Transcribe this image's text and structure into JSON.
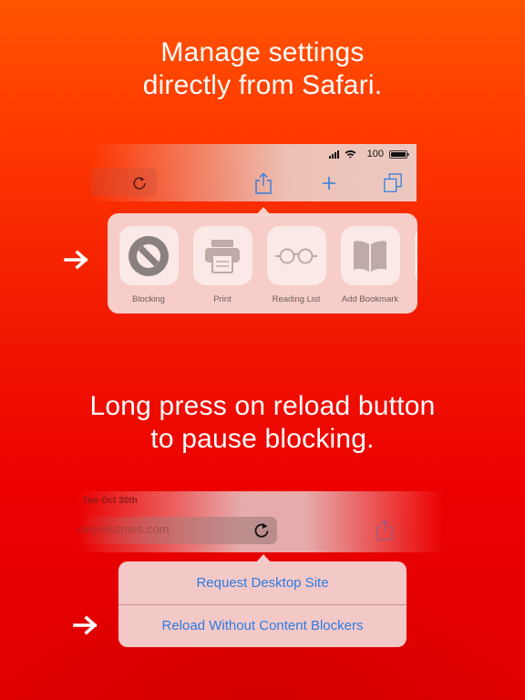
{
  "headlines": {
    "top": "Manage settings directly from Safari.",
    "bottom": "Long press on reload button to pause blocking."
  },
  "top_browser": {
    "status_bar": {
      "signal_icon": "cellular-signal-icon",
      "wifi_icon": "wifi-icon",
      "battery_percent": "100",
      "battery_icon": "battery-full-icon"
    },
    "toolbar": {
      "reload_icon": "reload-icon",
      "share_icon": "share-icon",
      "new_tab_icon": "plus-icon",
      "tabs_icon": "tabs-icon"
    },
    "share_sheet": {
      "actions": [
        {
          "label": "Blocking",
          "icon": "blocking-icon"
        },
        {
          "label": "Print",
          "icon": "printer-icon"
        },
        {
          "label": "Reading List",
          "icon": "glasses-icon"
        },
        {
          "label": "Add Bookmark",
          "icon": "book-icon"
        }
      ]
    }
  },
  "bottom_browser": {
    "date": "Tue Oct 30th",
    "url": "ewyorktimes.com",
    "reload_icon": "reload-icon",
    "share_icon": "share-icon",
    "menu": {
      "items": [
        {
          "label": "Request Desktop Site"
        },
        {
          "label": "Reload Without Content Blockers"
        }
      ]
    }
  },
  "colors": {
    "accent_blue": "#2d7be0",
    "background_top": "#ff5500",
    "background_bottom": "#e00000"
  }
}
